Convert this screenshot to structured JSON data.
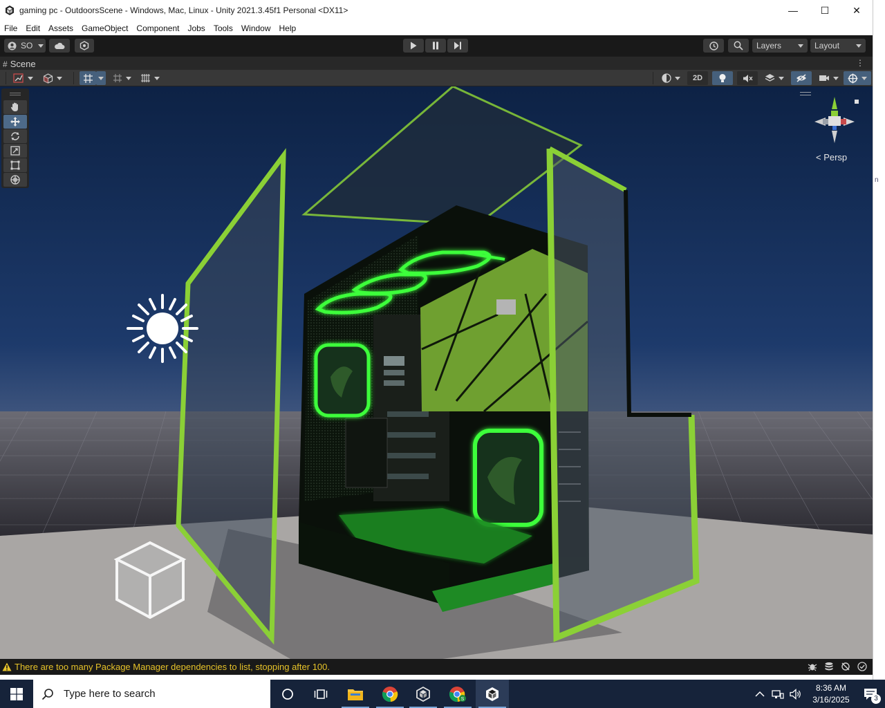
{
  "window": {
    "title": "gaming pc - OutdoorsScene - Windows, Mac, Linux - Unity 2021.3.45f1 Personal <DX11>",
    "minimize_glyph": "—",
    "maximize_glyph": "☐",
    "close_glyph": "✕"
  },
  "menu": [
    "File",
    "Edit",
    "Assets",
    "GameObject",
    "Component",
    "Jobs",
    "Tools",
    "Window",
    "Help"
  ],
  "toolbar": {
    "account_label": "SO",
    "layers_label": "Layers",
    "layout_label": "Layout"
  },
  "scene_tab": {
    "hash": "#",
    "label": "Scene",
    "menu_glyph": "⋮"
  },
  "scene_toolbar": {
    "mode_2d_label": "2D"
  },
  "gizmo": {
    "projection_label": "< Persp"
  },
  "status": {
    "message": "There are too many Package Manager dependencies to list, stopping after 100."
  },
  "right_strip": {
    "marker": "n"
  },
  "taskbar": {
    "search_placeholder": "Type here to search",
    "time": "8:36 AM",
    "date": "3/16/2025",
    "notification_count": "3"
  },
  "colors": {
    "accent_green": "#8bd036",
    "glow_green": "#3dff3a",
    "sky_top": "#0e2346",
    "sky_horizon": "#6f7b92",
    "ground": "#a9a6a4",
    "editor_dark": "#191919",
    "active_blue": "#46607c",
    "warning_yellow": "#e6c229",
    "taskbar": "#16233a"
  },
  "icons": {
    "unity": "unity-logo-icon",
    "play": "play-icon",
    "pause": "pause-icon",
    "step": "step-icon",
    "cloud": "cloud-icon",
    "collab": "collab-icon",
    "history": "history-icon",
    "search": "search-icon",
    "hand": "hand-tool-icon",
    "move": "move-tool-icon",
    "rotate": "rotate-tool-icon",
    "scale": "scale-tool-icon",
    "rect": "rect-tool-icon",
    "transform": "transform-tool-icon",
    "light": "directional-light-icon",
    "warning": "warning-icon"
  }
}
